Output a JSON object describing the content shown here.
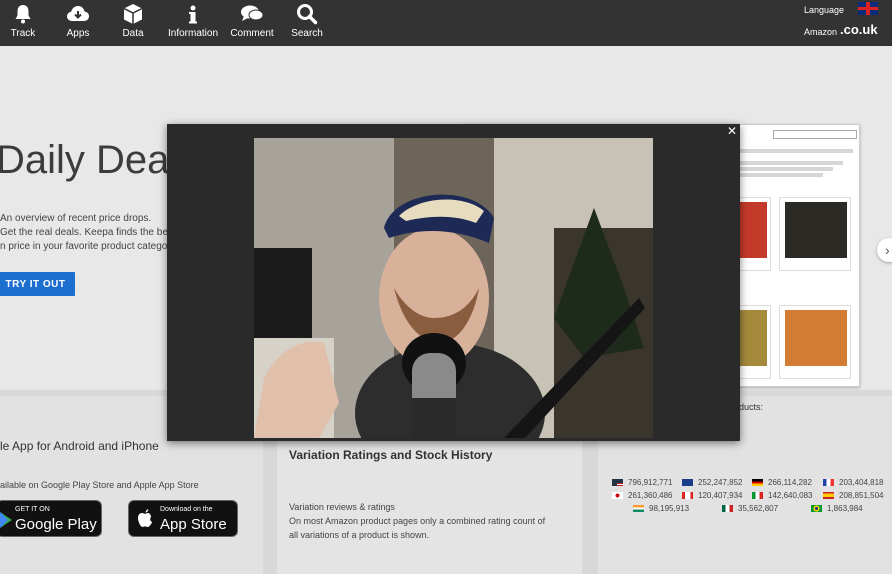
{
  "nav": {
    "items": [
      {
        "label": "Track",
        "icon": "bell-icon"
      },
      {
        "label": "Apps",
        "icon": "cloud-download-icon"
      },
      {
        "label": "Data",
        "icon": "cube-icon"
      },
      {
        "label": "Information",
        "icon": "info-icon"
      },
      {
        "label": "Comment",
        "icon": "chat-bubble-icon"
      },
      {
        "label": "Search",
        "icon": "search-icon"
      }
    ],
    "language_label": "Language",
    "amazon_label": "Amazon",
    "domain": ".co.uk",
    "language_flag": "uk-flag-icon"
  },
  "hero": {
    "title": "Daily Deals",
    "desc_lines": [
      "An overview of recent price drops.",
      "Get the real deals. Keepa finds the best",
      "n price in your favorite product catego"
    ],
    "cta_label": "TRY IT OUT",
    "next_icon": "chevron-right-icon"
  },
  "apps_section": {
    "title": "le App for Android and iPhone",
    "subtitle": "ailable on Google Play Store and Apple App Store",
    "google_play": {
      "small": "GET IT ON",
      "big": "Google Play"
    },
    "app_store": {
      "small": "Download on the",
      "big": "App Store"
    }
  },
  "variation_section": {
    "title": "Variation Ratings and Stock History",
    "desc_lines": [
      "Variation reviews & ratings",
      "On most Amazon product pages only a combined rating count of",
      "all variations of a product is shown."
    ]
  },
  "stats_section": {
    "title": "ducts:",
    "stats": [
      {
        "flag": "us-flag-icon",
        "value": "796,912,771"
      },
      {
        "flag": "uk-flag-icon",
        "value": "252,247,852"
      },
      {
        "flag": "de-flag-icon",
        "value": "266,114,282"
      },
      {
        "flag": "fr-flag-icon",
        "value": "203,404,818"
      },
      {
        "flag": "jp-flag-icon",
        "value": "261,360,486"
      },
      {
        "flag": "ca-flag-icon",
        "value": "120,407,934"
      },
      {
        "flag": "it-flag-icon",
        "value": "142,640,083"
      },
      {
        "flag": "es-flag-icon",
        "value": "208,851,504"
      },
      {
        "flag": "in-flag-icon",
        "value": "98,195,913"
      },
      {
        "flag": "mx-flag-icon",
        "value": "35,562,807"
      },
      {
        "flag": "br-flag-icon",
        "value": "1,863,984"
      }
    ]
  },
  "modal": {
    "close_label": "✕"
  }
}
